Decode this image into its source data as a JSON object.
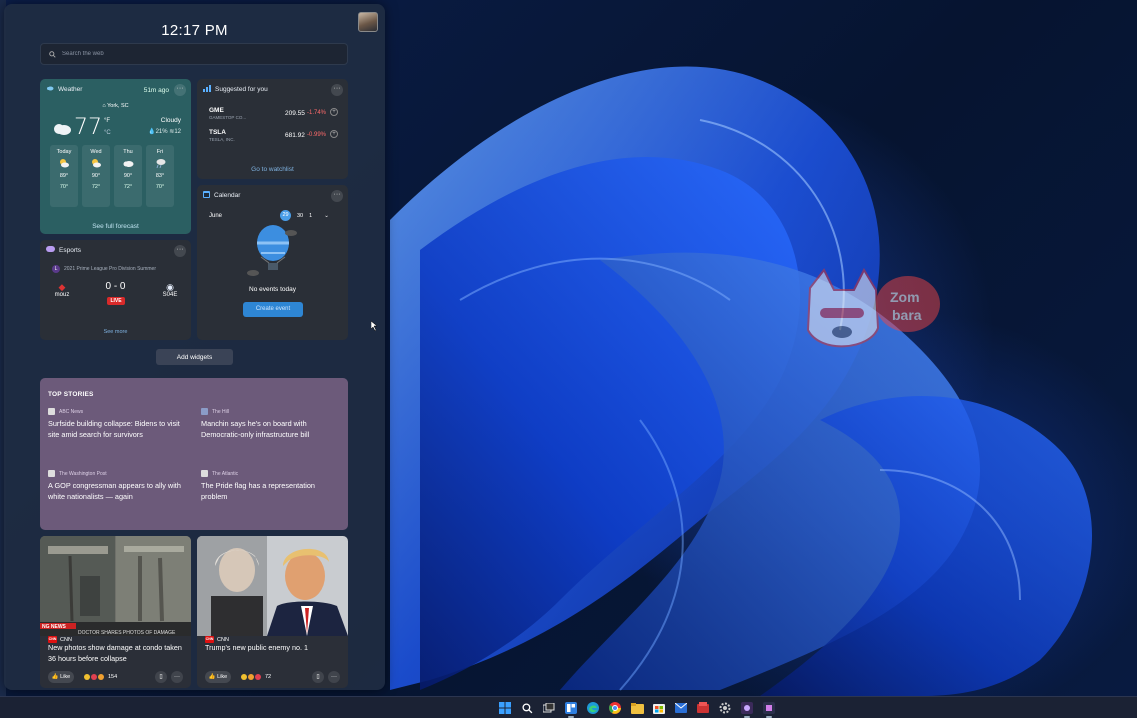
{
  "panel": {
    "time": "12:17 PM",
    "search_placeholder": "Search the web",
    "add_widgets": "Add widgets"
  },
  "weather": {
    "title": "Weather",
    "updated": "51m ago",
    "location": "York, SC",
    "temp": "77",
    "unit_f": "°F",
    "unit_c": "°C",
    "condition": "Cloudy",
    "precip": "21%",
    "wind": "12",
    "forecast": [
      {
        "day": "Today",
        "hi": "89°",
        "lo": "70°",
        "icon": "partly-sunny-icon"
      },
      {
        "day": "Wed",
        "hi": "90°",
        "lo": "72°",
        "icon": "partly-sunny-icon"
      },
      {
        "day": "Thu",
        "hi": "90°",
        "lo": "72°",
        "icon": "cloud-icon"
      },
      {
        "day": "Fri",
        "hi": "83°",
        "lo": "70°",
        "icon": "rain-icon"
      }
    ],
    "link": "See full forecast"
  },
  "stocks": {
    "title": "Suggested for you",
    "rows": [
      {
        "symbol": "GME",
        "name": "GAMESTOP CO...",
        "price": "209.55",
        "change": "-1.74%"
      },
      {
        "symbol": "TSLA",
        "name": "TESLA, INC.",
        "price": "681.92",
        "change": "-0.99%"
      }
    ],
    "link": "Go to watchlist"
  },
  "calendar": {
    "title": "Calendar",
    "month": "June",
    "days": [
      "29",
      "30",
      "1"
    ],
    "empty": "No events today",
    "create": "Create event"
  },
  "esports": {
    "title": "Esports",
    "league": "2021 Prime League Pro Division Summer",
    "league_badge": "L",
    "team1": "mouz",
    "team2": "S04E",
    "score": "0 - 0",
    "live": "LIVE",
    "link": "See more"
  },
  "top_stories": {
    "title": "TOP STORIES",
    "items": [
      {
        "source": "ABC News",
        "headline": "Surfside building collapse: Bidens to visit site amid search for survivors"
      },
      {
        "source": "The Hill",
        "headline": "Manchin says he's on board with Democratic-only infrastructure bill"
      },
      {
        "source": "The Washington Post",
        "headline": "A GOP congressman appears to ally with white nationalists — again"
      },
      {
        "source": "The Atlantic",
        "headline": "The Pride flag has a representation problem"
      }
    ]
  },
  "news_cards": [
    {
      "source": "CNN",
      "headline": "New photos show damage at condo taken 36 hours before collapse",
      "like": "Like",
      "reactions": "154",
      "photo_caption": "DOCTOR SHARES PHOTOS OF DAMAGE",
      "photo_tag": "NG NEWS"
    },
    {
      "source": "CNN",
      "headline": "Trump's new public enemy no. 1",
      "like": "Like",
      "reactions": "72"
    }
  ],
  "colors": {
    "weather_card": "#2b5f62",
    "stories_card": "#6c5a7a",
    "accent": "#2e86d4",
    "negative": "#ff6b6b",
    "live": "#d92a2a"
  },
  "watermark": {
    "text": "Zom bara"
  },
  "taskbar": {
    "icons": [
      "start-icon",
      "search-icon",
      "task-view-icon",
      "widgets-icon",
      "edge-icon",
      "chrome-icon",
      "file-explorer-icon",
      "store-icon",
      "mail-icon",
      "app-icon",
      "settings-icon",
      "app2-icon",
      "app3-icon"
    ]
  }
}
